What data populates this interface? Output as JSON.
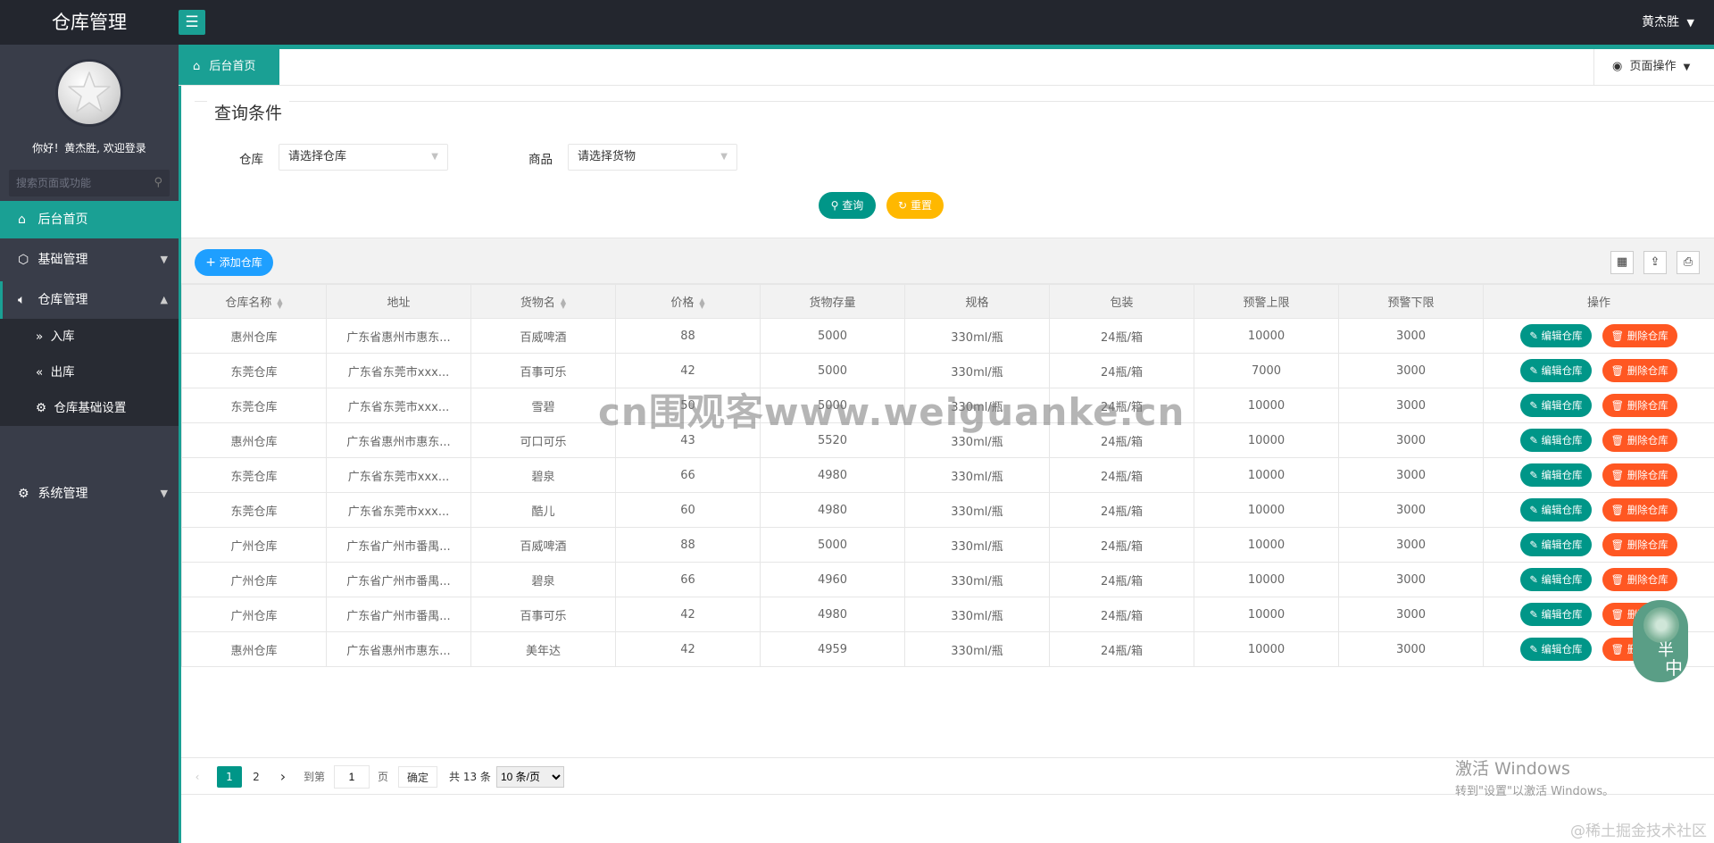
{
  "app": {
    "title": "仓库管理",
    "user": "黄杰胜",
    "caret": "▼"
  },
  "sidebar": {
    "welcome": "你好！黄杰胜, 欢迎登录",
    "search_placeholder": "搜索页面或功能",
    "items": [
      {
        "label": "后台首页",
        "icon": "home-icon"
      },
      {
        "label": "基础管理",
        "icon": "cube-icon"
      },
      {
        "label": "仓库管理",
        "icon": "volume-icon"
      },
      {
        "label": "系统管理",
        "icon": "gear-icon"
      }
    ],
    "sub_items": [
      {
        "label": "入库",
        "icon": "double-right-icon"
      },
      {
        "label": "出库",
        "icon": "double-left-icon"
      },
      {
        "label": "仓库基础设置",
        "icon": "gear-icon"
      }
    ]
  },
  "tabs": {
    "home": "后台首页",
    "page_ops": "页面操作"
  },
  "query": {
    "title": "查询条件",
    "warehouse_label": "仓库",
    "warehouse_placeholder": "请选择仓库",
    "goods_label": "商品",
    "goods_placeholder": "请选择货物",
    "search_btn": "查询",
    "reset_btn": "重置"
  },
  "toolbar": {
    "add_btn": "添加仓库"
  },
  "table": {
    "headers": [
      "仓库名称",
      "地址",
      "货物名",
      "价格",
      "货物存量",
      "规格",
      "包装",
      "预警上限",
      "预警下限",
      "操作"
    ],
    "edit_label": "编辑仓库",
    "delete_label": "删除仓库",
    "rows": [
      [
        "惠州仓库",
        "广东省惠州市惠东...",
        "百威啤酒",
        "88",
        "5000",
        "330ml/瓶",
        "24瓶/箱",
        "10000",
        "3000"
      ],
      [
        "东莞仓库",
        "广东省东莞市xxx...",
        "百事可乐",
        "42",
        "5000",
        "330ml/瓶",
        "24瓶/箱",
        "7000",
        "3000"
      ],
      [
        "东莞仓库",
        "广东省东莞市xxx...",
        "雪碧",
        "50",
        "5000",
        "330ml/瓶",
        "24瓶/箱",
        "10000",
        "3000"
      ],
      [
        "惠州仓库",
        "广东省惠州市惠东...",
        "可口可乐",
        "43",
        "5520",
        "330ml/瓶",
        "24瓶/箱",
        "10000",
        "3000"
      ],
      [
        "东莞仓库",
        "广东省东莞市xxx...",
        "碧泉",
        "66",
        "4980",
        "330ml/瓶",
        "24瓶/箱",
        "10000",
        "3000"
      ],
      [
        "东莞仓库",
        "广东省东莞市xxx...",
        "酷儿",
        "60",
        "4980",
        "330ml/瓶",
        "24瓶/箱",
        "10000",
        "3000"
      ],
      [
        "广州仓库",
        "广东省广州市番禺...",
        "百威啤酒",
        "88",
        "5000",
        "330ml/瓶",
        "24瓶/箱",
        "10000",
        "3000"
      ],
      [
        "广州仓库",
        "广东省广州市番禺...",
        "碧泉",
        "66",
        "4960",
        "330ml/瓶",
        "24瓶/箱",
        "10000",
        "3000"
      ],
      [
        "广州仓库",
        "广东省广州市番禺...",
        "百事可乐",
        "42",
        "4980",
        "330ml/瓶",
        "24瓶/箱",
        "10000",
        "3000"
      ],
      [
        "惠州仓库",
        "广东省惠州市惠东...",
        "美年达",
        "42",
        "4959",
        "330ml/瓶",
        "24瓶/箱",
        "10000",
        "3000"
      ]
    ]
  },
  "pagination": {
    "pages": [
      "1",
      "2"
    ],
    "current": "1",
    "goto_label": "到第",
    "goto_value": "1",
    "page_unit": "页",
    "confirm": "确定",
    "total": "共 13 条",
    "page_size": "10 条/页"
  },
  "overlay": {
    "watermark": "cn围观客www.weiguanke.cn",
    "win_line1": "激活 Windows",
    "win_line2": "转到\"设置\"以激活 Windows。",
    "juejin": "@稀土掘金技术社区",
    "widget_t1": "半",
    "widget_t2": "中"
  }
}
